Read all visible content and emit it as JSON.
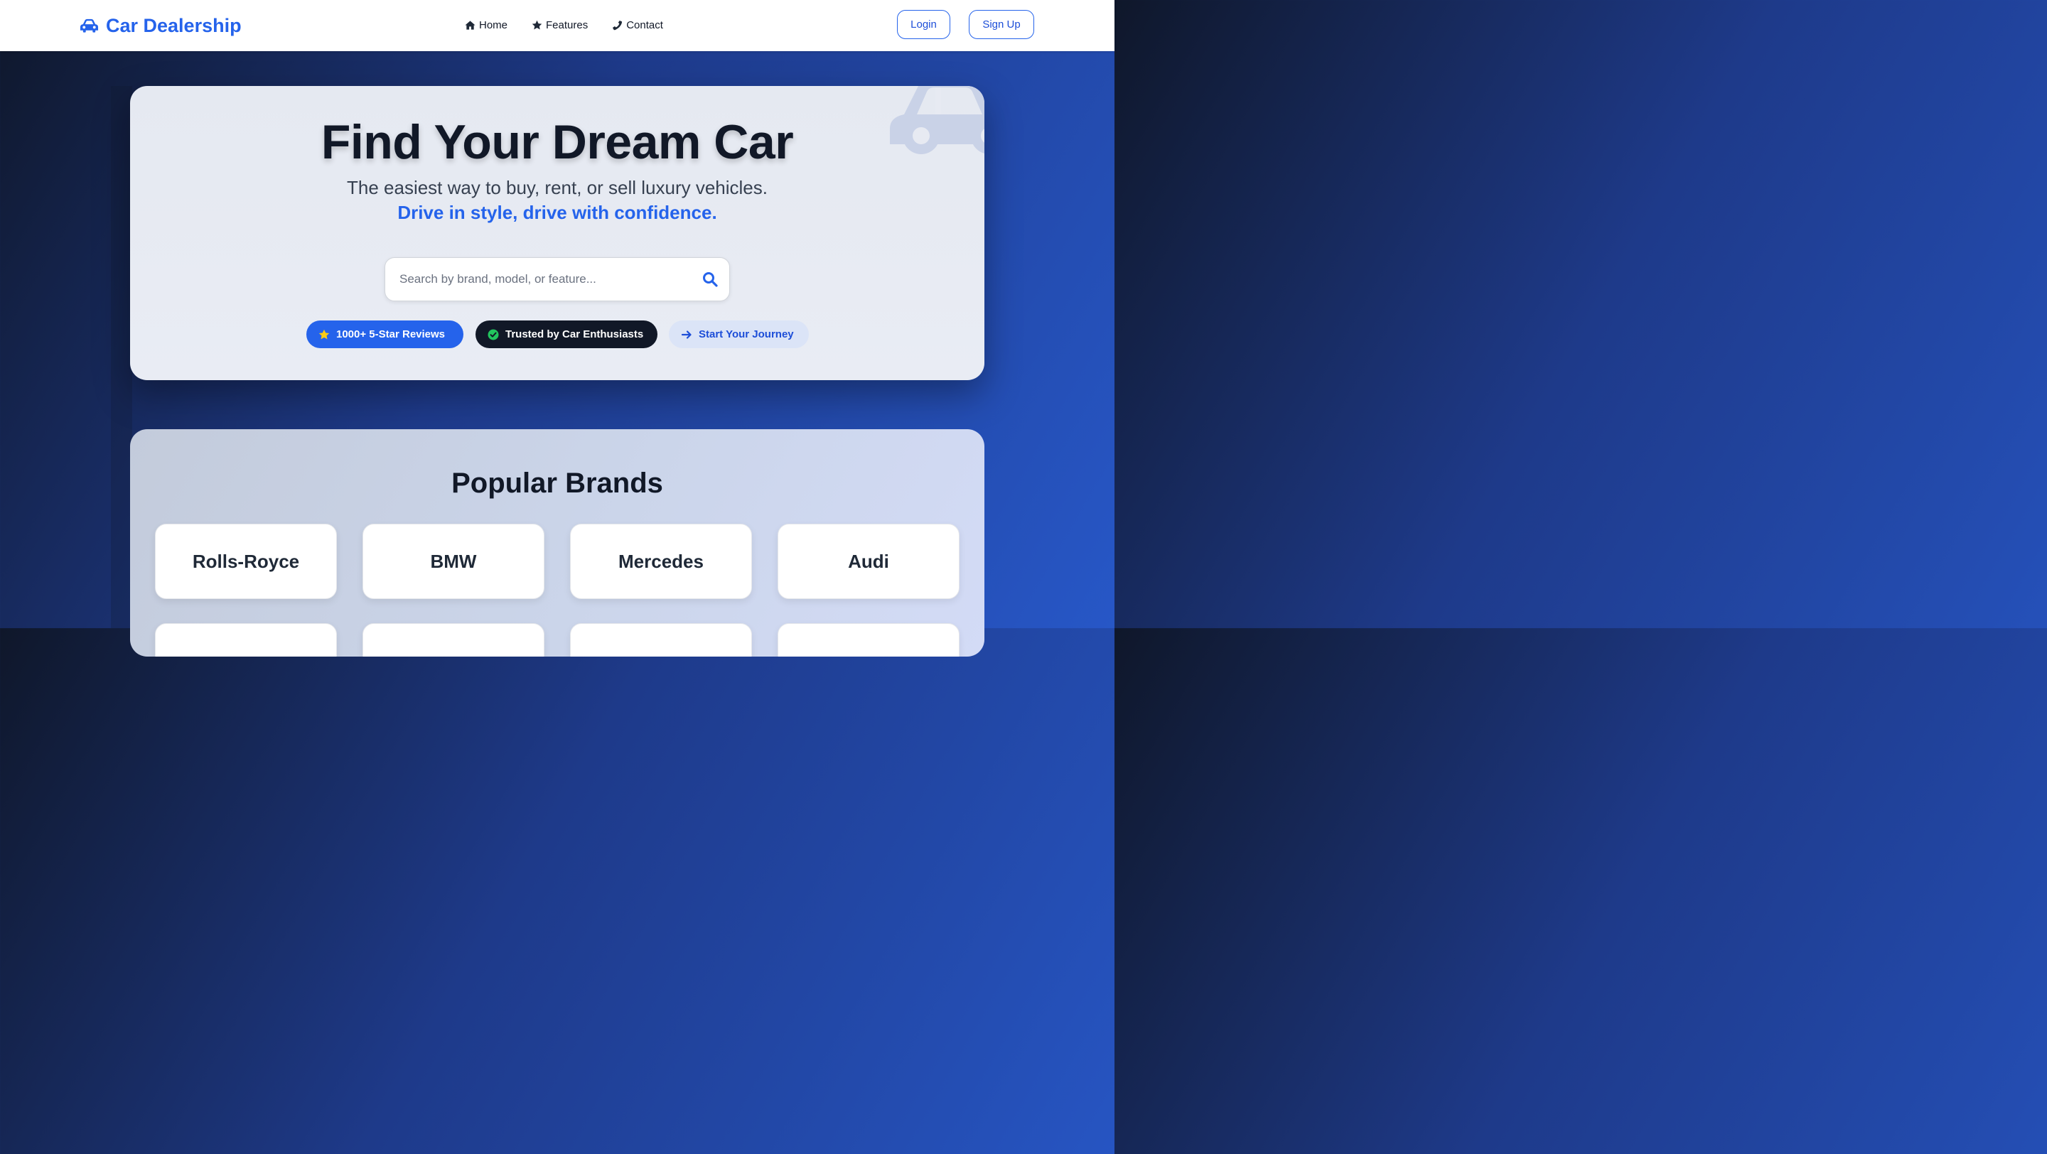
{
  "navbar": {
    "brand_name": "Car Dealership",
    "brand_icon": "car-icon",
    "links": [
      {
        "label": "Home",
        "icon": "home-icon"
      },
      {
        "label": "Features",
        "icon": "star-icon"
      },
      {
        "label": "Contact",
        "icon": "phone-icon"
      }
    ],
    "login_label": "Login",
    "signup_label": "Sign Up"
  },
  "hero": {
    "title": "Find Your Dream Car",
    "subtitle": "The easiest way to buy, rent, or sell luxury vehicles.",
    "tagline": "Drive in style, drive with confidence.",
    "search": {
      "placeholder": "Search by brand, model, or feature...",
      "value": ""
    },
    "badges": [
      {
        "label": "1000+ 5-Star Reviews",
        "icon": "star-icon"
      },
      {
        "label": "Trusted by Car Enthusiasts",
        "icon": "check-circle-icon"
      },
      {
        "label": "Start Your Journey",
        "icon": "arrow-right-icon"
      }
    ]
  },
  "brands": {
    "title": "Popular Brands",
    "items": [
      "Rolls-Royce",
      "BMW",
      "Mercedes",
      "Audi",
      "",
      "",
      "",
      ""
    ]
  },
  "colors": {
    "accent": "#2563eb",
    "dark": "#111827",
    "check_green": "#22c55e",
    "star_yellow": "#facc15"
  }
}
